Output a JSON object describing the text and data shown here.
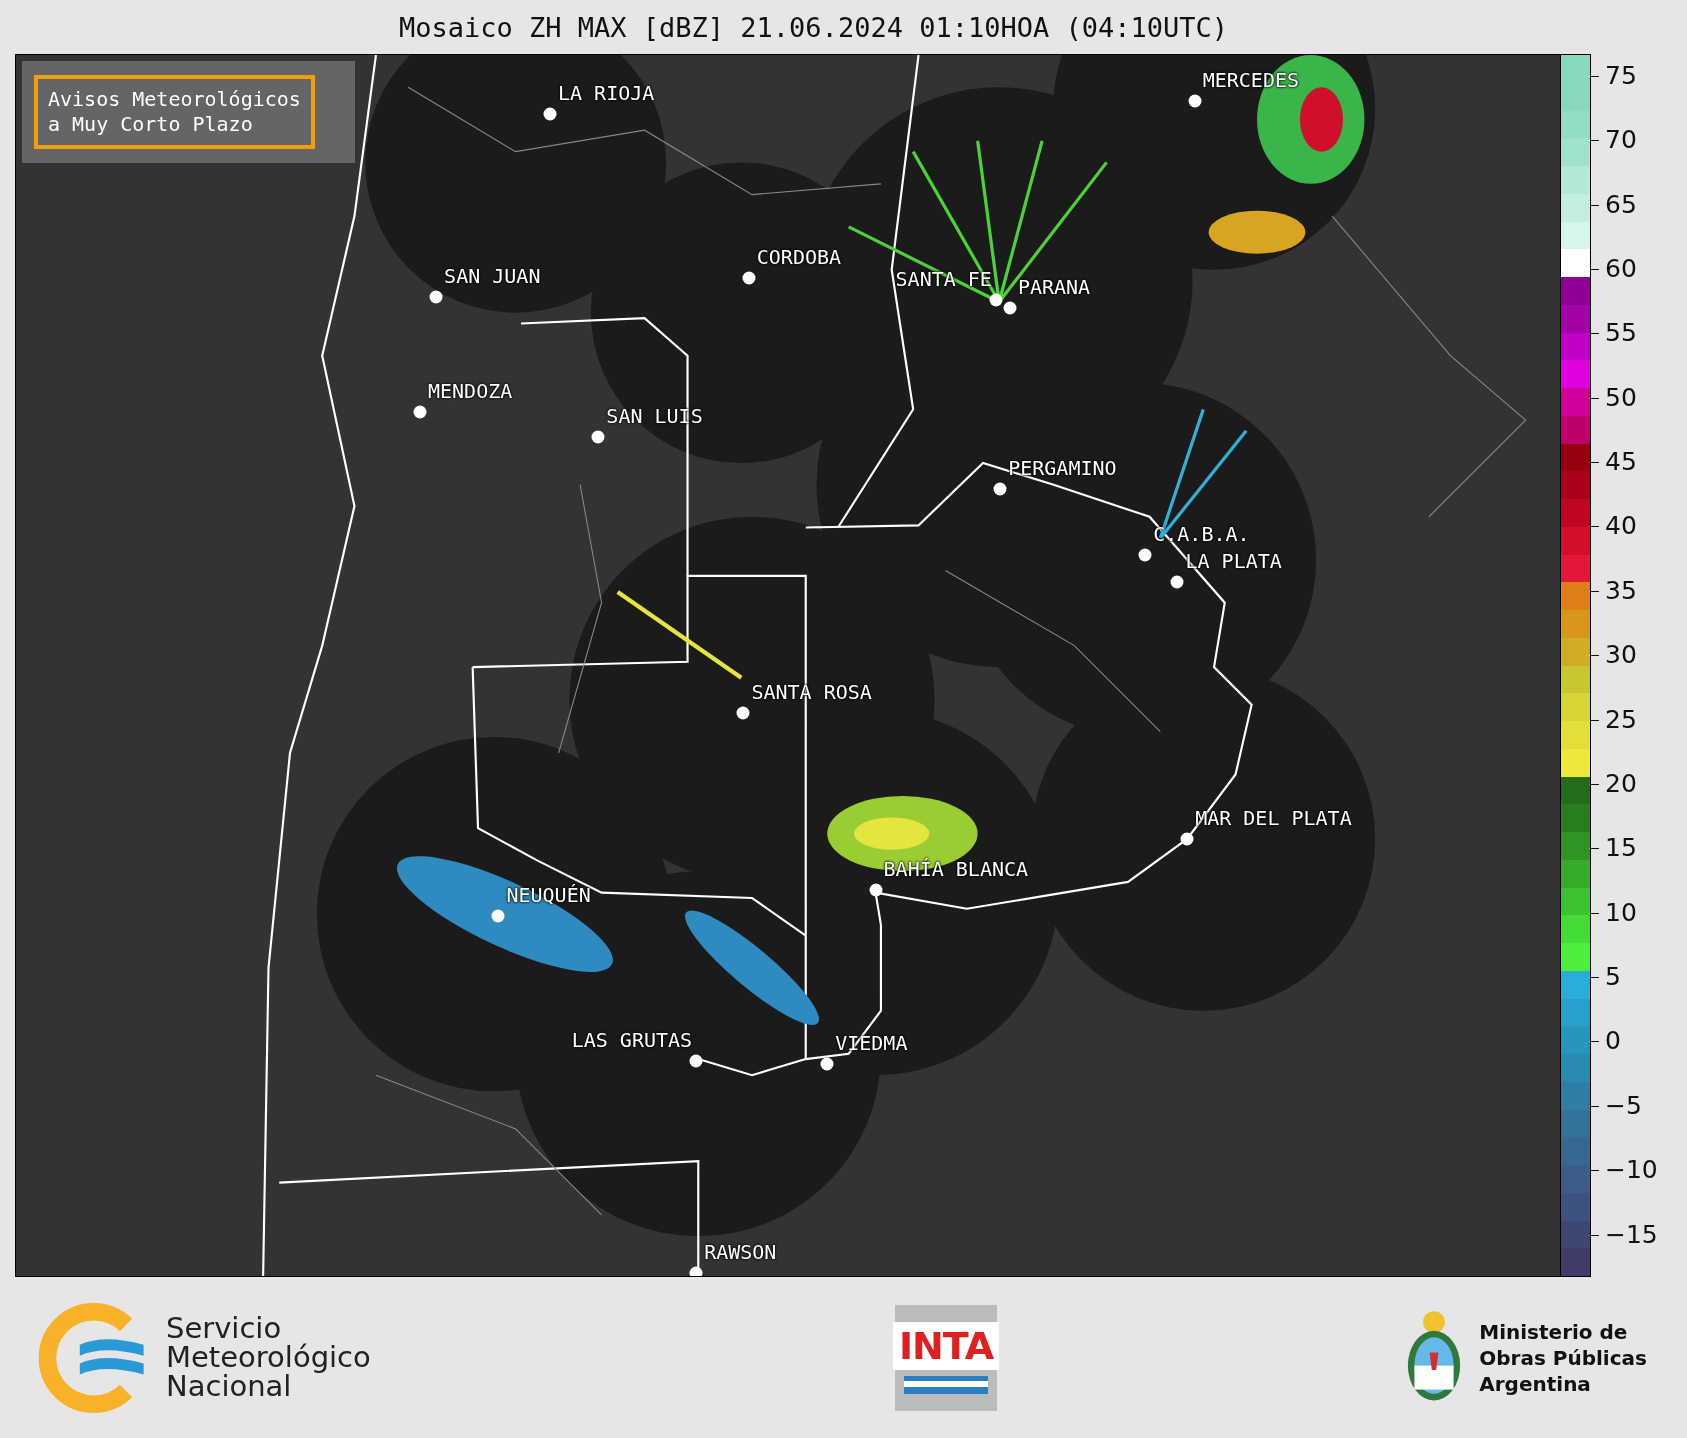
{
  "title": "Mosaico ZH MAX [dBZ] 21.06.2024 01:10HOA (04:10UTC)",
  "notice": {
    "lines": [
      "Avisos Meteorológicos",
      "a Muy Corto Plazo"
    ]
  },
  "cities": [
    {
      "name": "LA RIOJA"
    },
    {
      "name": "MERCEDES"
    },
    {
      "name": "CORDOBA"
    },
    {
      "name": "SAN JUAN"
    },
    {
      "name": "SANTA FE"
    },
    {
      "name": "PARANA"
    },
    {
      "name": "MENDOZA"
    },
    {
      "name": "SAN LUIS"
    },
    {
      "name": "PERGAMINO"
    },
    {
      "name": "C.A.B.A."
    },
    {
      "name": "LA PLATA"
    },
    {
      "name": "SANTA ROSA"
    },
    {
      "name": "MAR DEL PLATA"
    },
    {
      "name": "BAHÍA BLANCA"
    },
    {
      "name": "NEUQUÉN"
    },
    {
      "name": "LAS GRUTAS"
    },
    {
      "name": "VIEDMA"
    },
    {
      "name": "RAWSON"
    }
  ],
  "colorbar": {
    "ticks": [
      "75",
      "70",
      "65",
      "60",
      "55",
      "50",
      "45",
      "40",
      "35",
      "30",
      "25",
      "20",
      "15",
      "10",
      "5",
      "0",
      "−5",
      "−10",
      "−15"
    ]
  },
  "footer": {
    "smn_lines": [
      "Servicio",
      "Meteorológico",
      "Nacional"
    ],
    "inta": "INTA",
    "ministry_lines": [
      "Ministerio de",
      "Obras Públicas",
      "Argentina"
    ]
  }
}
